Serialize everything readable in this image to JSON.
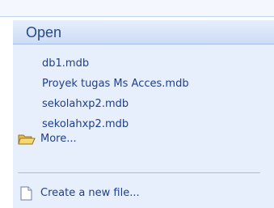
{
  "section": {
    "title": "Open"
  },
  "files": [
    {
      "name": "db1.mdb"
    },
    {
      "name": "Proyek tugas Ms Acces.mdb"
    },
    {
      "name": "sekolahxp2.mdb"
    },
    {
      "name": "sekolahxp2.mdb"
    }
  ],
  "more": {
    "label": "More...",
    "icon": "open-folder-icon"
  },
  "create": {
    "label": "Create a new file...",
    "icon": "new-document-icon"
  },
  "colors": {
    "link": "#1d3f8e",
    "header_text": "#274a82",
    "panel_bg": "#e8effc"
  }
}
